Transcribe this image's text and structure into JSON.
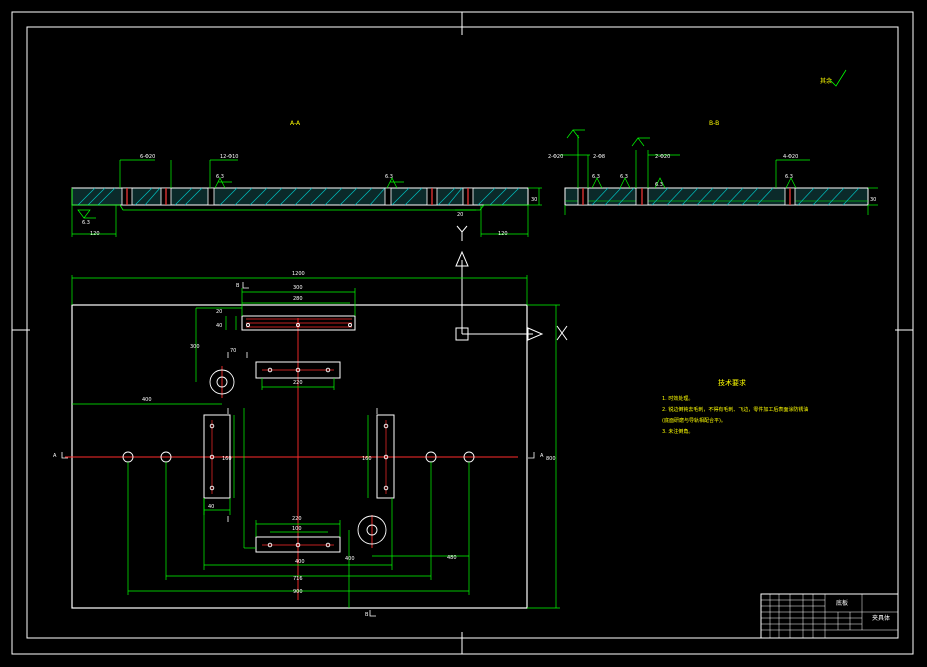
{
  "view_labels": {
    "section_a": "A-A",
    "section_b": "B-B",
    "axis_x": "X",
    "axis_y": "Y"
  },
  "top_note": "其余",
  "section_marks": {
    "a_left": "A",
    "a_right": "A",
    "b_top": "B",
    "b_bottom": "B"
  },
  "dims_section_a": {
    "d1": "6-Φ20",
    "d2": "12-Φ10",
    "r1": "6.3",
    "r2": "6.3",
    "r3": "6.3",
    "left_w": "120",
    "right_w": "120",
    "h": "30",
    "depth": "20"
  },
  "dims_section_b": {
    "d1": "2-Φ20",
    "d2": "2-Φ8",
    "d3": "2-Φ20",
    "d4": "4-Φ20",
    "r1": "6.3",
    "r2": "6.3",
    "r3": "6.3",
    "r4": "6.3",
    "h": "30"
  },
  "dims_plan": {
    "overall_w": "1200",
    "overall_h": "800",
    "slot_w1": "300",
    "slot_w2": "280",
    "slot_h1": "20",
    "slot_h2": "40",
    "v_left": "300",
    "h_left": "400",
    "mid_w": "220",
    "mid_h": "70",
    "side_h1": "160",
    "side_h2": "160",
    "side_w": "40",
    "bot_w1": "220",
    "bot_w2": "100",
    "c1": "400",
    "c2": "400",
    "c3": "716",
    "c4": "900",
    "c5": "480"
  },
  "tech": {
    "title": "技术要求",
    "lines": [
      "1. 时效处理。",
      "2. 锐边倒钝去毛刺，不得有毛刺、飞边，零件加工后表面涂防锈油",
      "(底面研磨与导轨相配合平)。",
      "3. 未注倒角。"
    ]
  },
  "title_block": {
    "drawing_label": "底板",
    "part_name": "夹具体"
  }
}
